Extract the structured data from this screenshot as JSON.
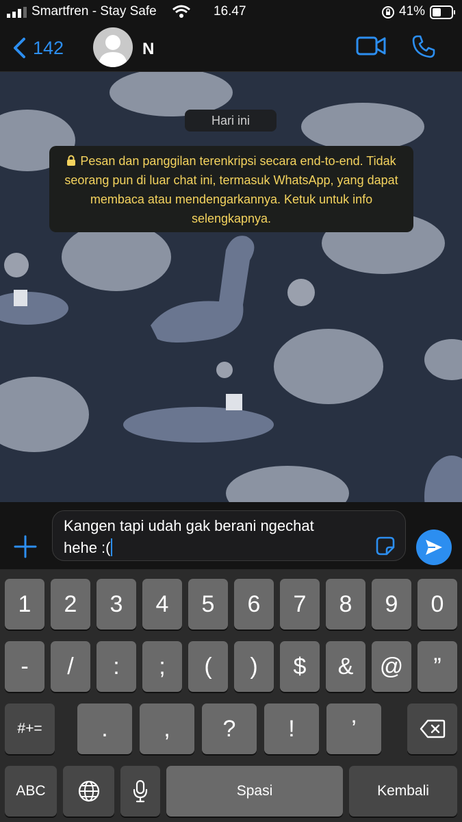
{
  "status_bar": {
    "carrier": "Smartfren - Stay Safe",
    "time": "16.47",
    "battery": "41%",
    "icons": [
      "signal-icon",
      "wifi-icon",
      "orientation-lock-icon",
      "battery-icon"
    ]
  },
  "header": {
    "back_count": "142",
    "contact_name": "N",
    "icons": [
      "back-chevron-icon",
      "avatar-icon",
      "video-call-icon",
      "phone-icon"
    ]
  },
  "chat": {
    "date_chip": "Hari ini",
    "encryption_notice": "Pesan dan panggilan terenkripsi secara end-to-end. Tidak seorang pun di luar chat ini, termasuk WhatsApp, yang dapat membaca atau mendengarkannya. Ketuk untuk info selengkapnya."
  },
  "composer": {
    "input_value": "Kangen tapi udah gak berani ngechat\nhehe :(",
    "icons": [
      "plus-icon",
      "sticker-icon",
      "send-icon"
    ]
  },
  "keyboard": {
    "row1": [
      "1",
      "2",
      "3",
      "4",
      "5",
      "6",
      "7",
      "8",
      "9",
      "0"
    ],
    "row2": [
      "-",
      "/",
      ":",
      ";",
      "(",
      ")",
      "$",
      "&",
      "@",
      "”"
    ],
    "row3_toggle": "#+=",
    "row3": [
      ".",
      ",",
      "?",
      "!",
      "’"
    ],
    "abc": "ABC",
    "space": "Spasi",
    "return": "Kembali",
    "icons": [
      "globe-icon",
      "microphone-icon",
      "delete-icon"
    ]
  },
  "colors": {
    "accent": "#2c8ef0",
    "notice_text": "#f4d35e",
    "wallpaper": "#283142"
  }
}
